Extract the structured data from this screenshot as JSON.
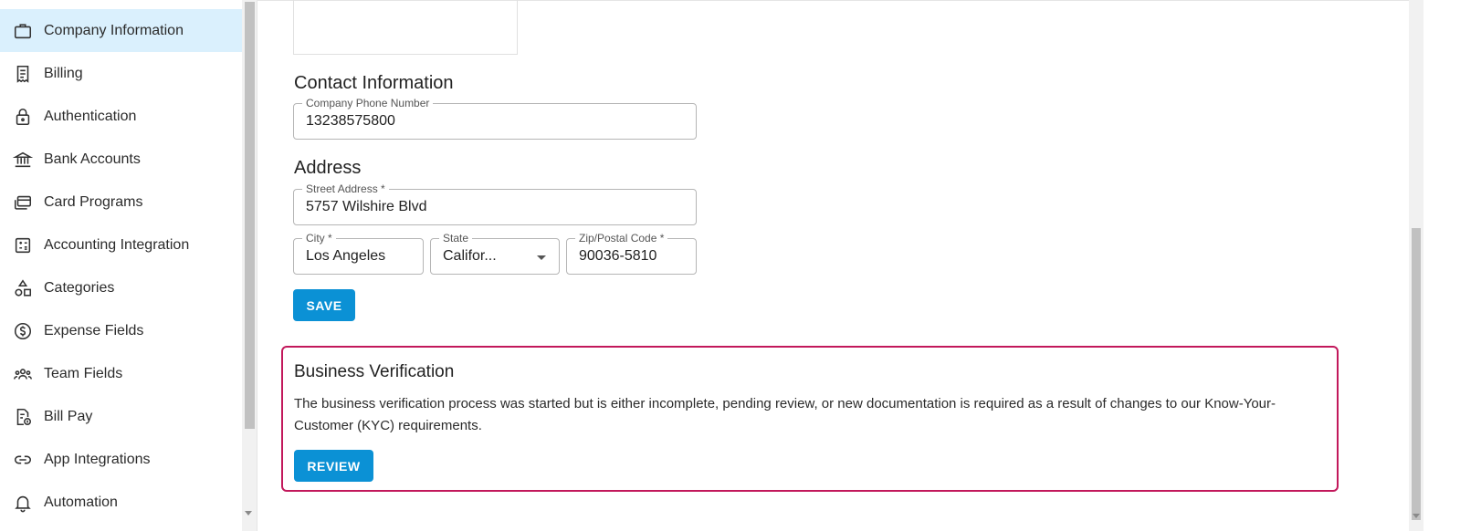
{
  "sidebar": {
    "items": [
      {
        "label": "Company Information",
        "icon": "briefcase-icon",
        "active": true
      },
      {
        "label": "Billing",
        "icon": "receipt-icon"
      },
      {
        "label": "Authentication",
        "icon": "lock-icon"
      },
      {
        "label": "Bank Accounts",
        "icon": "bank-icon"
      },
      {
        "label": "Card Programs",
        "icon": "cards-icon"
      },
      {
        "label": "Accounting Integration",
        "icon": "calculator-icon"
      },
      {
        "label": "Categories",
        "icon": "shapes-icon"
      },
      {
        "label": "Expense Fields",
        "icon": "dollar-circle-icon"
      },
      {
        "label": "Team Fields",
        "icon": "team-icon"
      },
      {
        "label": "Bill Pay",
        "icon": "bill-icon"
      },
      {
        "label": "App Integrations",
        "icon": "link-icon"
      },
      {
        "label": "Automation",
        "icon": "bell-icon"
      }
    ]
  },
  "contact": {
    "heading": "Contact Information",
    "phone_label": "Company Phone Number",
    "phone_value": "13238575800"
  },
  "address": {
    "heading": "Address",
    "street_label": "Street Address *",
    "street_value": "5757 Wilshire Blvd",
    "city_label": "City *",
    "city_value": "Los Angeles",
    "state_label": "State",
    "state_value": "Califor...",
    "zip_label": "Zip/Postal Code *",
    "zip_value": "90036-5810"
  },
  "save_label": "SAVE",
  "verification": {
    "heading": "Business Verification",
    "description": "The business verification process was started but is either incomplete, pending review, or new documentation is required as a result of changes to our Know-Your-Customer (KYC) requirements.",
    "review_label": "REVIEW"
  },
  "colors": {
    "accent": "#0b91d5",
    "active_bg": "#daf0fd",
    "verify_border": "#c2185b"
  }
}
